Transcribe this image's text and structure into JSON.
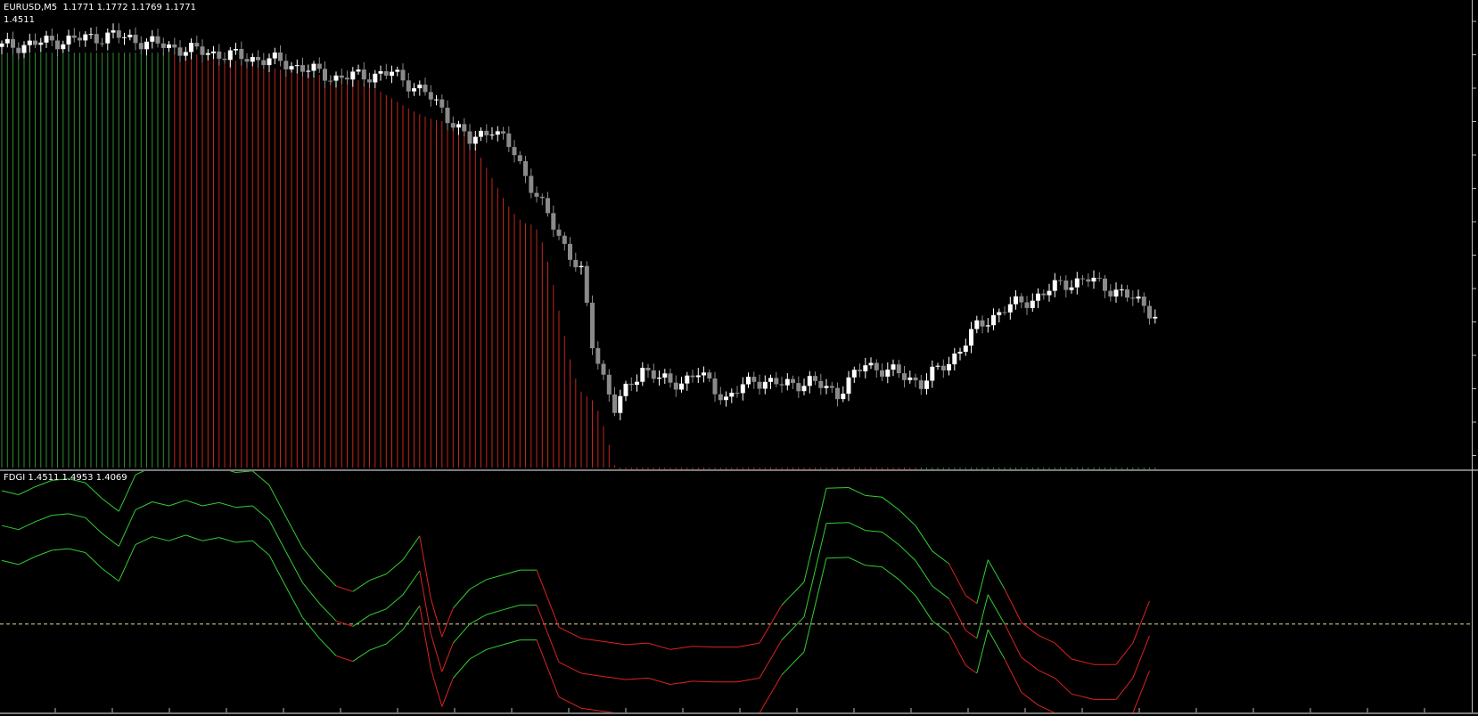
{
  "main_window": {
    "symbol_line": "EURUSD,M5  1.1771 1.1772 1.1769 1.1771",
    "value_line": "1.4511"
  },
  "indicator_window": {
    "label": "FDGI 1.4511 1.4953 1.4069"
  },
  "colors": {
    "background": "#000000",
    "bull_histogram": "#2e8b32",
    "bear_histogram": "#c1261b",
    "bull_line": "#32cd32",
    "bear_line": "#dd2222",
    "level_line": "#e8d8a0",
    "candle_up": "#ffffff",
    "candle_down": "#8a8a8a"
  },
  "chart_data": [
    {
      "type": "candlestick",
      "bars": 208,
      "histogram": {
        "description_note": "vertical histogram lines from the chart bottom to the indicator value",
        "segments": [
          {
            "from_bar": 0,
            "to_bar": 30,
            "color": "bull"
          },
          {
            "from_bar": 31,
            "to_bar": 164,
            "color": "bear"
          },
          {
            "from_bar": 165,
            "to_bar": 207,
            "color": "bull"
          }
        ],
        "curve_x": [
          0,
          30,
          60,
          80,
          95,
          105,
          115,
          125,
          135,
          145,
          155,
          165,
          175,
          185,
          195,
          207
        ],
        "curve_y": [
          1.18,
          1.18,
          1.178,
          1.174,
          1.165,
          1.15,
          1.138,
          1.13,
          1.126,
          1.124,
          1.124,
          1.122,
          1.124,
          1.127,
          1.13,
          1.134
        ]
      },
      "candles": {
        "x": [
          0,
          10,
          20,
          30,
          40,
          50,
          60,
          70,
          76,
          80,
          84,
          88,
          92,
          96,
          100,
          104,
          106,
          110,
          115,
          120,
          125,
          130,
          135,
          140,
          145,
          150,
          155,
          160,
          165,
          170,
          175,
          180,
          185,
          190,
          195,
          200,
          205,
          207
        ],
        "close": [
          1.1805,
          1.181,
          1.1815,
          1.1805,
          1.1798,
          1.1792,
          1.1778,
          1.1782,
          1.1765,
          1.1745,
          1.1722,
          1.1735,
          1.1712,
          1.1675,
          1.164,
          1.1608,
          1.1545,
          1.149,
          1.1525,
          1.151,
          1.152,
          1.1498,
          1.1515,
          1.151,
          1.1513,
          1.1503,
          1.1528,
          1.1521,
          1.1512,
          1.153,
          1.156,
          1.1577,
          1.1585,
          1.1598,
          1.1602,
          1.1592,
          1.158,
          1.1571
        ],
        "ylim": [
          1.1438,
          1.1835
        ]
      },
      "ylim": [
        1.1438,
        1.1835
      ]
    },
    {
      "type": "line",
      "title": "FDGI",
      "x": [
        0,
        3,
        6,
        9,
        12,
        15,
        18,
        21,
        24,
        27,
        30,
        33,
        36,
        39,
        42,
        45,
        48,
        51,
        54,
        57,
        60,
        63,
        66,
        69,
        72,
        75,
        77,
        79,
        81,
        84,
        87,
        90,
        93,
        96,
        100,
        104,
        108,
        112,
        116,
        120,
        124,
        128,
        132,
        136,
        140,
        144,
        148,
        152,
        155,
        158,
        161,
        164,
        167,
        170,
        173,
        175,
        177,
        180,
        183,
        186,
        189,
        192,
        196,
        200,
        203,
        206
      ],
      "series": [
        {
          "name": "FDGI",
          "values": [
            1.72,
            1.67,
            1.77,
            1.85,
            1.87,
            1.82,
            1.62,
            1.46,
            1.92,
            2.02,
            1.97,
            2.04,
            1.97,
            2.01,
            1.95,
            1.97,
            1.79,
            1.39,
            1.0,
            0.74,
            0.52,
            0.45,
            0.59,
            0.67,
            0.85,
            1.15,
            0.36,
            -0.12,
            0.24,
            0.48,
            0.6,
            0.66,
            0.72,
            0.72,
            0.0,
            -0.14,
            -0.18,
            -0.22,
            -0.2,
            -0.28,
            -0.24,
            -0.25,
            -0.25,
            -0.2,
            0.28,
            0.57,
            1.75,
            1.76,
            1.66,
            1.64,
            1.48,
            1.28,
            0.96,
            0.8,
            0.4,
            0.3,
            0.85,
            0.48,
            0.06,
            -0.1,
            -0.2,
            -0.4,
            -0.47,
            -0.47,
            -0.2,
            0.33
          ]
        }
      ],
      "band_offset": 0.44,
      "level": 0.48,
      "ylim": [
        -0.6,
        2.25
      ]
    }
  ]
}
